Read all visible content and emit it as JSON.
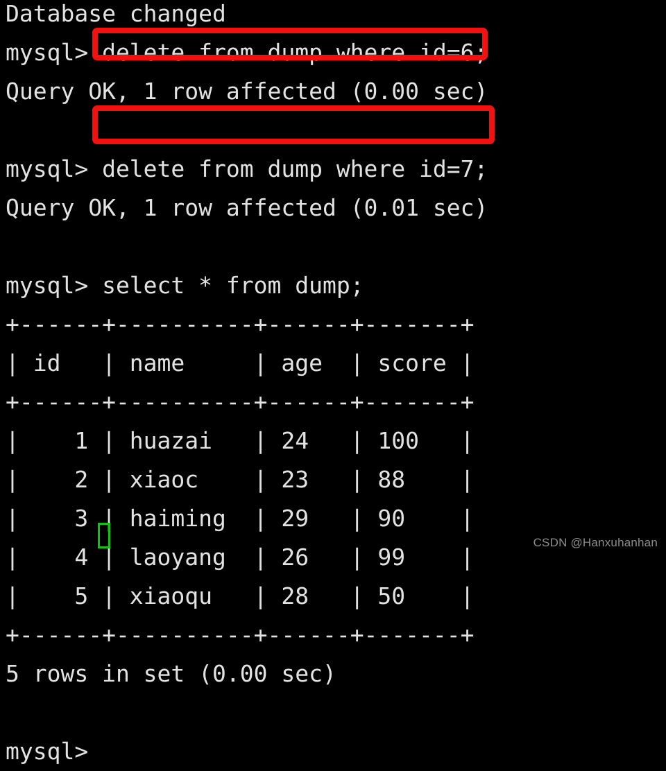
{
  "terminal": {
    "prompt": "mysql> ",
    "background_color": "#000000",
    "text_color": "#e2e2e2",
    "highlight_color": "#f21111",
    "cursor_color": "#11c411",
    "lines": [
      "Database changed",
      "mysql> delete from dump where id=6;",
      "Query OK, 1 row affected (0.00 sec)",
      "",
      "mysql> delete from dump where id=7;",
      "Query OK, 1 row affected (0.01 sec)",
      "",
      "mysql> select * from dump;",
      "+------+----------+------+-------+",
      "| id   | name     | age  | score |",
      "+------+----------+------+-------+",
      "|    1 | huazai   | 24   | 100   |",
      "|    2 | xiaoc    | 23   | 88    |",
      "|    3 | haiming  | 29   | 90    |",
      "|    4 | laoyang  | 26   | 99    |",
      "|    5 | xiaoqu   | 28   | 50    |",
      "+------+----------+------+-------+",
      "5 rows in set (0.00 sec)",
      "",
      "mysql> "
    ],
    "highlighted_commands": [
      "delete from dump where id=6;",
      "delete from dump where id=7;"
    ],
    "result_table": {
      "headers": [
        "id",
        "name",
        "age",
        "score"
      ],
      "rows": [
        [
          "1",
          "huazai",
          "24",
          "100"
        ],
        [
          "2",
          "xiaoc",
          "23",
          "88"
        ],
        [
          "3",
          "haiming",
          "29",
          "90"
        ],
        [
          "4",
          "laoyang",
          "26",
          "99"
        ],
        [
          "5",
          "xiaoqu",
          "28",
          "50"
        ]
      ],
      "row_count_text": "5 rows in set (0.00 sec)"
    }
  },
  "watermark": {
    "text": "CSDN @Hanxuhanhan"
  }
}
